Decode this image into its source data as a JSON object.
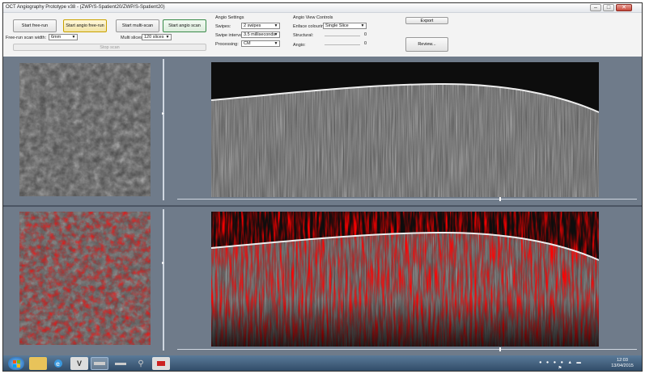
{
  "window": {
    "title": "OCT Angiography Prototype v38 - (ZWP/S-Spatient20/ZWP/S-Spatient20)"
  },
  "toolbar": {
    "start_free_run": "Start free-run",
    "start_angio_free_run": "Start angio free-run",
    "start_multi_scan": "Start multi-scan",
    "start_angio_scan": "Start angio scan",
    "free_run_scan_width_label": "Free-run scan width:",
    "free_run_scan_width_value": "6mm",
    "multi_slices_label": "Multi slices:",
    "multi_slices_value": "120 slices",
    "stop_scan": "Stop scan"
  },
  "angio_settings": {
    "title": "Angio Settings",
    "swipes_label": "Swipes:",
    "swipes_value": "2 swipes",
    "swipe_interval_label": "Swipe interval:",
    "swipe_interval_value": "3.5 milliseconds",
    "processing_label": "Processing:",
    "processing_value": "CM"
  },
  "angio_view": {
    "title": "Angio View Controls",
    "enface_colouring_label": "Enface colouring:",
    "enface_colouring_value": "Single Slice",
    "structural_label": "Structural:",
    "structural_value": "0",
    "angio_label": "Angio:",
    "angio_value": "0"
  },
  "actions": {
    "export": "Export",
    "review": "Review..."
  },
  "scrollbars": {
    "top_position": 0.7,
    "bottom_position": 0.7
  },
  "taskbar": {
    "time": "12:03",
    "date": "13/04/2015",
    "icons": [
      "windows-start-icon",
      "file-explorer-icon",
      "ie-browser-icon",
      "v-app-icon",
      "oct-app-icon",
      "scanner-icon",
      "microscope-icon",
      "image-app-icon"
    ]
  },
  "colors": {
    "panel_bg": "#6f7b8a",
    "angio_red": "#e02020",
    "yellow_border": "#c9a100",
    "green_border": "#3a8a4a"
  }
}
